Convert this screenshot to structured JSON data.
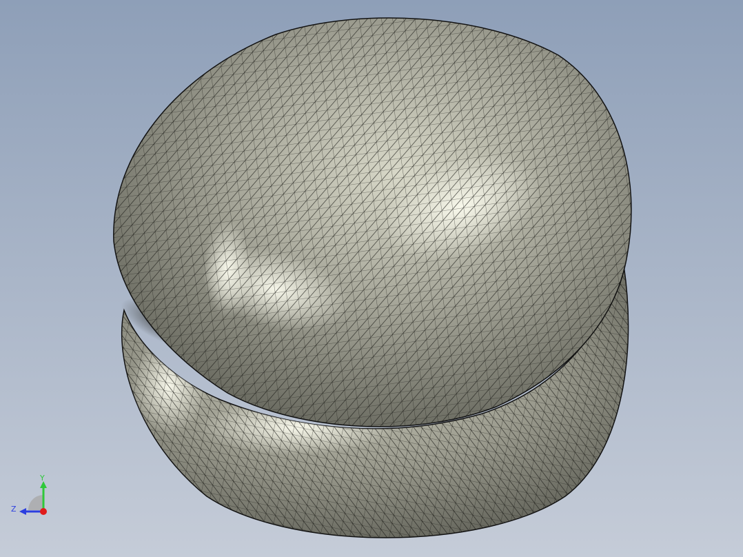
{
  "viewport": {
    "background_top": "#8e9fb8",
    "background_bottom": "#c5ccd8",
    "model_name": "mesh-body",
    "model_fill_dark": "#55564d",
    "model_fill_mid": "#a3a396",
    "model_fill_light": "#f3f3e4",
    "mesh_line_color": "#1b1b17"
  },
  "triad": {
    "y_label": "Y",
    "z_label": "Z",
    "y_color": "#2fc83a",
    "z_color": "#2b3ee0",
    "x_color": "#e01b1b"
  }
}
